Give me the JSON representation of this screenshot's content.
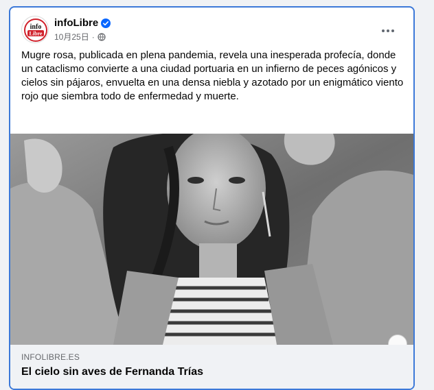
{
  "post": {
    "page_name": "infoLibre",
    "timestamp": "10月25日",
    "text": "Mugre rosa, publicada en plena pandemia, revela una inesperada profecía, donde un cataclismo convierte a una ciudad portuaria en un infierno de peces agónicos y cielos sin pájaros, envuelta en una densa niebla y azotado por un enigmático viento rojo que siembra todo de enfermedad y muerte."
  },
  "avatar": {
    "logo_line1": "info",
    "logo_line2": "Libre"
  },
  "link_preview": {
    "domain": "INFOLIBRE.ES",
    "title": "El cielo sin aves de Fernanda Trías"
  },
  "icons": {
    "verified": "verified-badge-icon",
    "audience": "globe-icon",
    "more": "more-options-icon"
  },
  "colors": {
    "accent_border": "#3b78d8",
    "verified_blue": "#0866ff",
    "logo_red": "#d0202a"
  }
}
